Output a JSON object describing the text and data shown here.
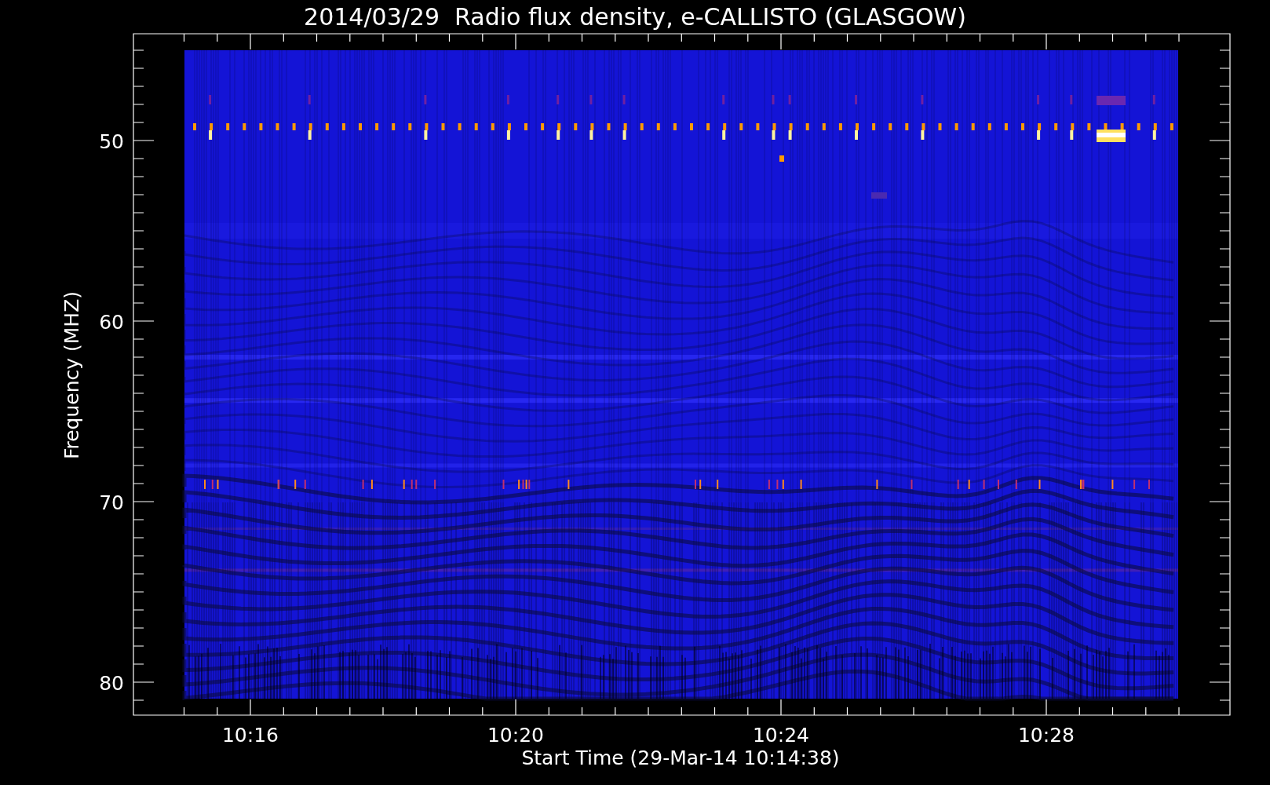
{
  "title": "2014/03/29  Radio flux density, e-CALLISTO (GLASGOW)",
  "y_axis": {
    "label": "Frequency (MHZ)",
    "ticks": [
      "50",
      "60",
      "70",
      "80"
    ]
  },
  "x_axis": {
    "label": "Start Time (29-Mar-14 10:14:38)",
    "ticks": [
      "10:16",
      "10:20",
      "10:24",
      "10:28"
    ]
  }
}
